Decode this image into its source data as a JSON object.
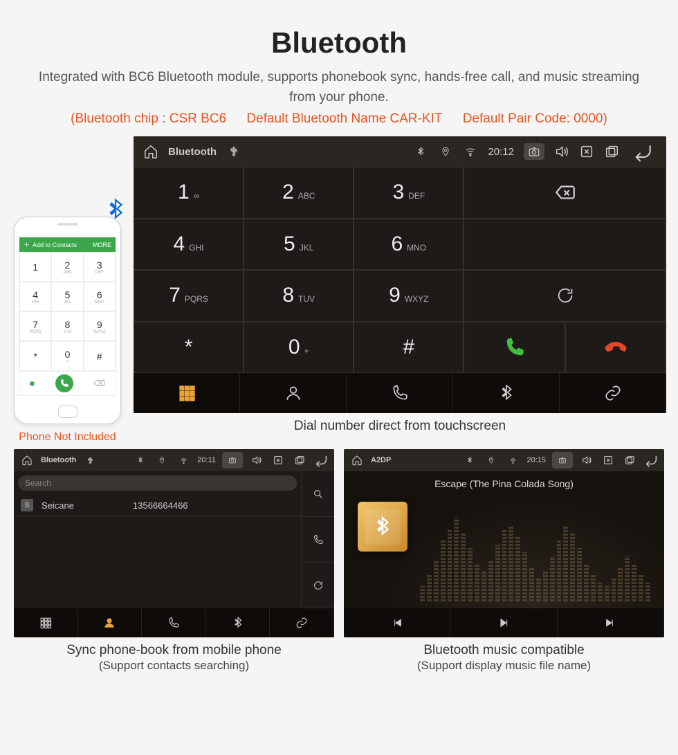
{
  "header": {
    "title": "Bluetooth",
    "description": "Integrated with BC6 Bluetooth module, supports phonebook sync, hands-free call, and music streaming from your phone.",
    "spec_chip": "(Bluetooth chip : CSR BC6",
    "spec_name": "Default Bluetooth Name CAR-KIT",
    "spec_code": "Default Pair Code: 0000)"
  },
  "phone": {
    "label": "Phone Not Included",
    "top_bar": "Add to Contacts",
    "top_right": "MORE",
    "keys": [
      {
        "n": "1",
        "l": ""
      },
      {
        "n": "2",
        "l": "ABC"
      },
      {
        "n": "3",
        "l": "DEF"
      },
      {
        "n": "4",
        "l": "GHI"
      },
      {
        "n": "5",
        "l": "JKL"
      },
      {
        "n": "6",
        "l": "MNO"
      },
      {
        "n": "7",
        "l": "PQRS"
      },
      {
        "n": "8",
        "l": "TUV"
      },
      {
        "n": "9",
        "l": "WXYZ"
      },
      {
        "n": "*",
        "l": ""
      },
      {
        "n": "0",
        "l": "+"
      },
      {
        "n": "#",
        "l": ""
      }
    ]
  },
  "dialer": {
    "statusbar": {
      "title": "Bluetooth",
      "time": "20:12"
    },
    "keys": [
      {
        "n": "1",
        "l": "∞"
      },
      {
        "n": "2",
        "l": "ABC"
      },
      {
        "n": "3",
        "l": "DEF"
      },
      {
        "n": "4",
        "l": "GHI"
      },
      {
        "n": "5",
        "l": "JKL"
      },
      {
        "n": "6",
        "l": "MNO"
      },
      {
        "n": "7",
        "l": "PQRS"
      },
      {
        "n": "8",
        "l": "TUV"
      },
      {
        "n": "9",
        "l": "WXYZ"
      },
      {
        "n": "*",
        "l": ""
      },
      {
        "n": "0",
        "l": "+"
      },
      {
        "n": "#",
        "l": ""
      }
    ],
    "caption": "Dial number direct from touchscreen"
  },
  "contacts": {
    "statusbar": {
      "title": "Bluetooth",
      "time": "20:11"
    },
    "search_placeholder": "Search",
    "rows": [
      {
        "badge": "S",
        "name": "Seicane",
        "number": "13566664466"
      }
    ],
    "caption_line1": "Sync phone-book from mobile phone",
    "caption_line2": "(Support contacts searching)"
  },
  "music": {
    "statusbar": {
      "title": "A2DP",
      "time": "20:15"
    },
    "song": "Escape (The Pina Colada Song)",
    "caption_line1": "Bluetooth music compatible",
    "caption_line2": "(Support display music file name)"
  },
  "icons": {
    "home": "home-icon",
    "usb": "usb-icon",
    "bt": "bluetooth-icon",
    "gps": "location-icon",
    "wifi": "wifi-icon",
    "camera": "camera-icon",
    "volume": "volume-icon",
    "close": "close-box-icon",
    "recent": "recent-apps-icon",
    "back": "back-icon",
    "backspace": "backspace-icon",
    "refresh": "refresh-icon",
    "call": "call-icon",
    "hangup": "hangup-icon",
    "grid": "keypad-icon",
    "person": "contacts-icon",
    "phone": "phone-icon",
    "link": "link-icon",
    "search": "search-icon",
    "prev": "prev-track-icon",
    "play": "play-pause-icon",
    "next": "next-track-icon"
  }
}
